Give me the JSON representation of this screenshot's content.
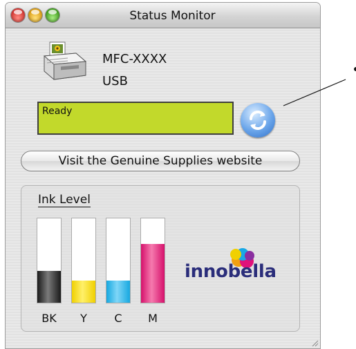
{
  "window": {
    "title": "Status Monitor"
  },
  "device": {
    "name": "MFC-XXXX",
    "port": "USB"
  },
  "status": {
    "text": "Ready",
    "color": "#c2d92b"
  },
  "buttons": {
    "visit_label": "Visit the Genuine Supplies website"
  },
  "ink": {
    "title": "Ink Level",
    "levels": [
      {
        "label": "BK",
        "level": 0.38,
        "color": "#1a1a1a",
        "highlight": "#7a7a7a"
      },
      {
        "label": "Y",
        "level": 0.26,
        "color": "#f0d000",
        "highlight": "#fff06a"
      },
      {
        "label": "C",
        "level": 0.26,
        "color": "#16a8e0",
        "highlight": "#7fd6f7"
      },
      {
        "label": "M",
        "level": 0.7,
        "color": "#d6106b",
        "highlight": "#f57aae"
      }
    ]
  },
  "logo": {
    "text": "innobella"
  }
}
